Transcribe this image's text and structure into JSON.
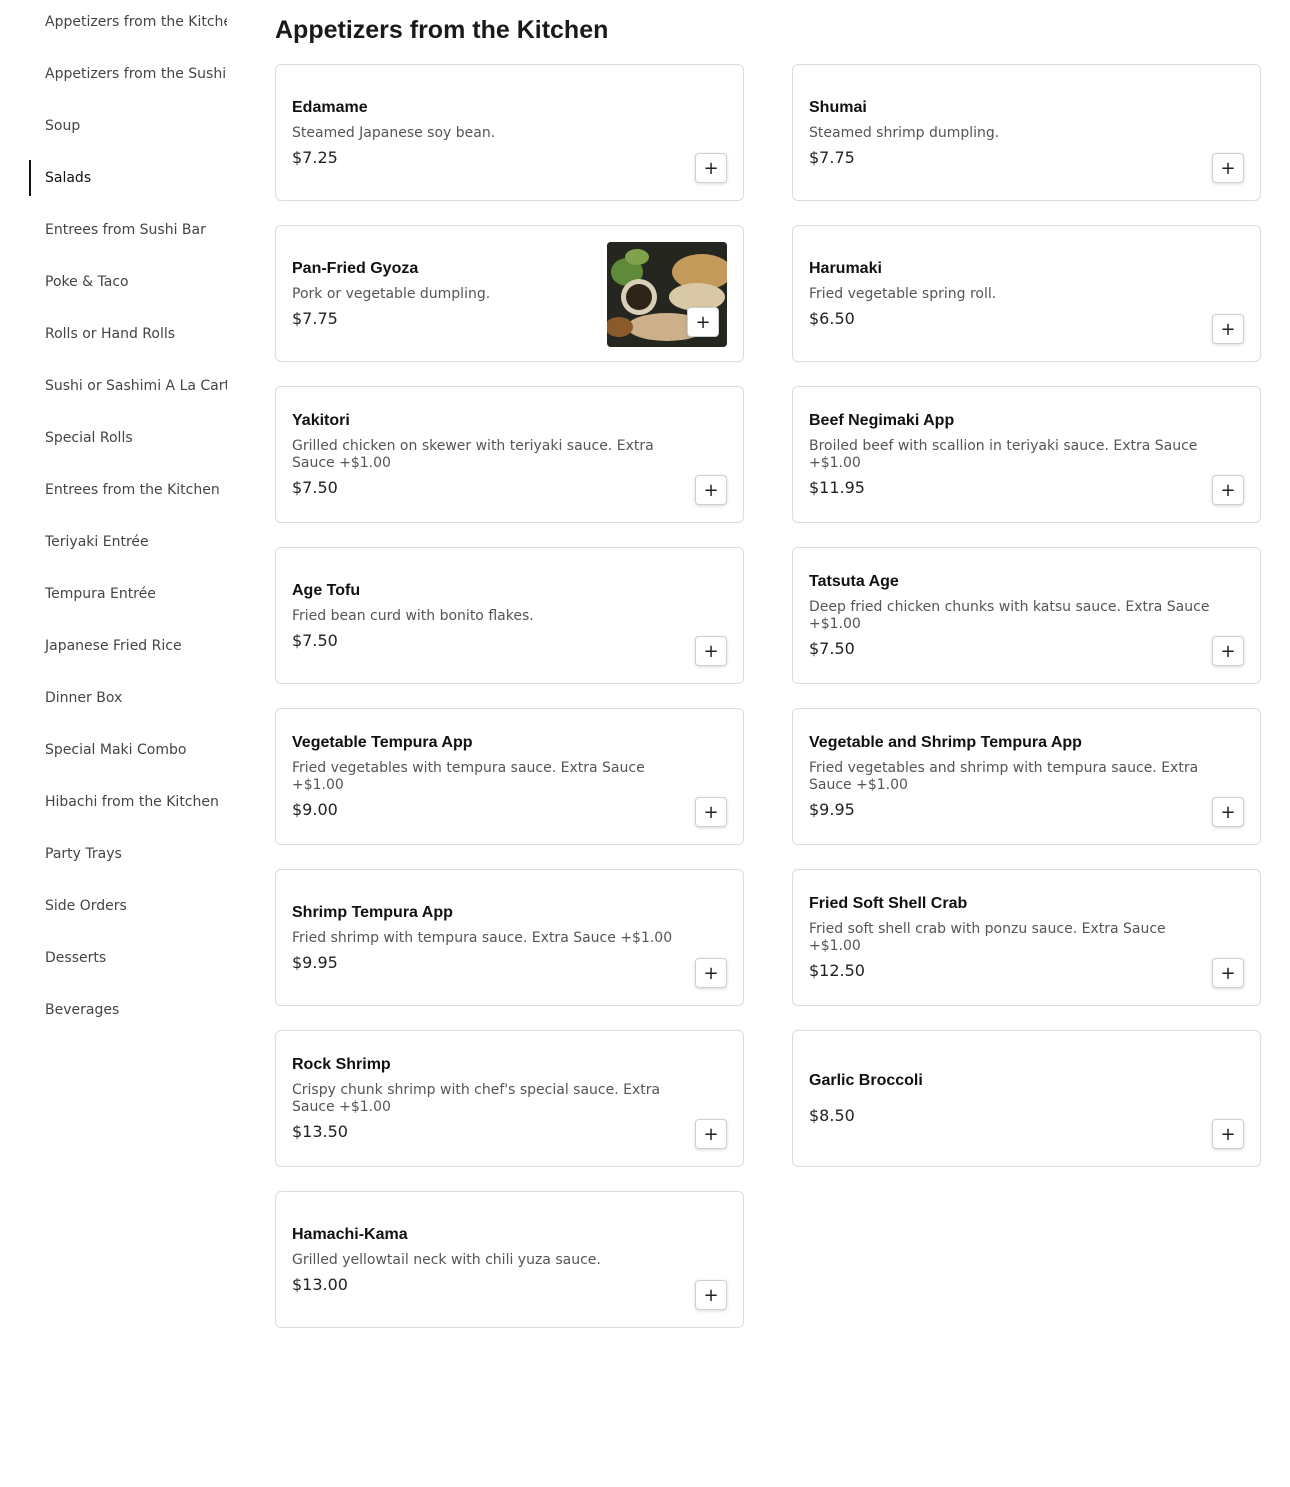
{
  "sidebar": {
    "items": [
      {
        "label": "Appetizers from the Kitchen",
        "active": false
      },
      {
        "label": "Appetizers from the Sushi Bar",
        "active": false
      },
      {
        "label": "Soup",
        "active": false
      },
      {
        "label": "Salads",
        "active": true
      },
      {
        "label": "Entrees from Sushi Bar",
        "active": false
      },
      {
        "label": "Poke & Taco",
        "active": false
      },
      {
        "label": "Rolls or Hand Rolls",
        "active": false
      },
      {
        "label": "Sushi or Sashimi A La Carte",
        "active": false
      },
      {
        "label": "Special Rolls",
        "active": false
      },
      {
        "label": "Entrees from the Kitchen",
        "active": false
      },
      {
        "label": "Teriyaki Entrée",
        "active": false
      },
      {
        "label": "Tempura Entrée",
        "active": false
      },
      {
        "label": "Japanese Fried Rice",
        "active": false
      },
      {
        "label": "Dinner Box",
        "active": false
      },
      {
        "label": "Special Maki Combo",
        "active": false
      },
      {
        "label": "Hibachi from the Kitchen",
        "active": false
      },
      {
        "label": "Party Trays",
        "active": false
      },
      {
        "label": "Side Orders",
        "active": false
      },
      {
        "label": "Desserts",
        "active": false
      },
      {
        "label": "Beverages",
        "active": false
      }
    ]
  },
  "section": {
    "title": "Appetizers from the Kitchen",
    "add_icon": "plus-icon",
    "add_glyph": "+",
    "items": [
      {
        "name": "Edamame",
        "description": "Steamed Japanese soy bean.",
        "price": "$7.25",
        "has_image": false
      },
      {
        "name": "Shumai",
        "description": "Steamed shrimp dumpling.",
        "price": "$7.75",
        "has_image": false
      },
      {
        "name": "Pan-Fried Gyoza",
        "description": "Pork or vegetable dumpling.",
        "price": "$7.75",
        "has_image": true
      },
      {
        "name": "Harumaki",
        "description": "Fried vegetable spring roll.",
        "price": "$6.50",
        "has_image": false
      },
      {
        "name": "Yakitori",
        "description": "Grilled chicken on skewer with teriyaki sauce. Extra Sauce +$1.00",
        "price": "$7.50",
        "has_image": false
      },
      {
        "name": "Beef Negimaki App",
        "description": "Broiled beef with scallion in teriyaki sauce. Extra Sauce +$1.00",
        "price": "$11.95",
        "has_image": false
      },
      {
        "name": "Age Tofu",
        "description": "Fried bean curd with bonito flakes.",
        "price": "$7.50",
        "has_image": false
      },
      {
        "name": "Tatsuta Age",
        "description": "Deep fried chicken chunks with katsu sauce. Extra Sauce +$1.00",
        "price": "$7.50",
        "has_image": false
      },
      {
        "name": "Vegetable Tempura App",
        "description": "Fried vegetables with tempura sauce. Extra Sauce +$1.00",
        "price": "$9.00",
        "has_image": false
      },
      {
        "name": "Vegetable and Shrimp Tempura App",
        "description": "Fried vegetables and shrimp with tempura sauce. Extra Sauce +$1.00",
        "price": "$9.95",
        "has_image": false
      },
      {
        "name": "Shrimp Tempura App",
        "description": "Fried shrimp with tempura sauce. Extra Sauce +$1.00",
        "price": "$9.95",
        "has_image": false
      },
      {
        "name": "Fried Soft Shell Crab",
        "description": "Fried soft shell crab with ponzu sauce. Extra Sauce +$1.00",
        "price": "$12.50",
        "has_image": false
      },
      {
        "name": "Rock Shrimp",
        "description": "Crispy chunk shrimp with chef's special sauce. Extra Sauce +$1.00",
        "price": "$13.50",
        "has_image": false
      },
      {
        "name": "Garlic Broccoli",
        "description": "",
        "price": "$8.50",
        "has_image": false
      },
      {
        "name": "Hamachi-Kama",
        "description": "Grilled yellowtail neck with chili yuza sauce.",
        "price": "$13.00",
        "has_image": false
      }
    ]
  }
}
